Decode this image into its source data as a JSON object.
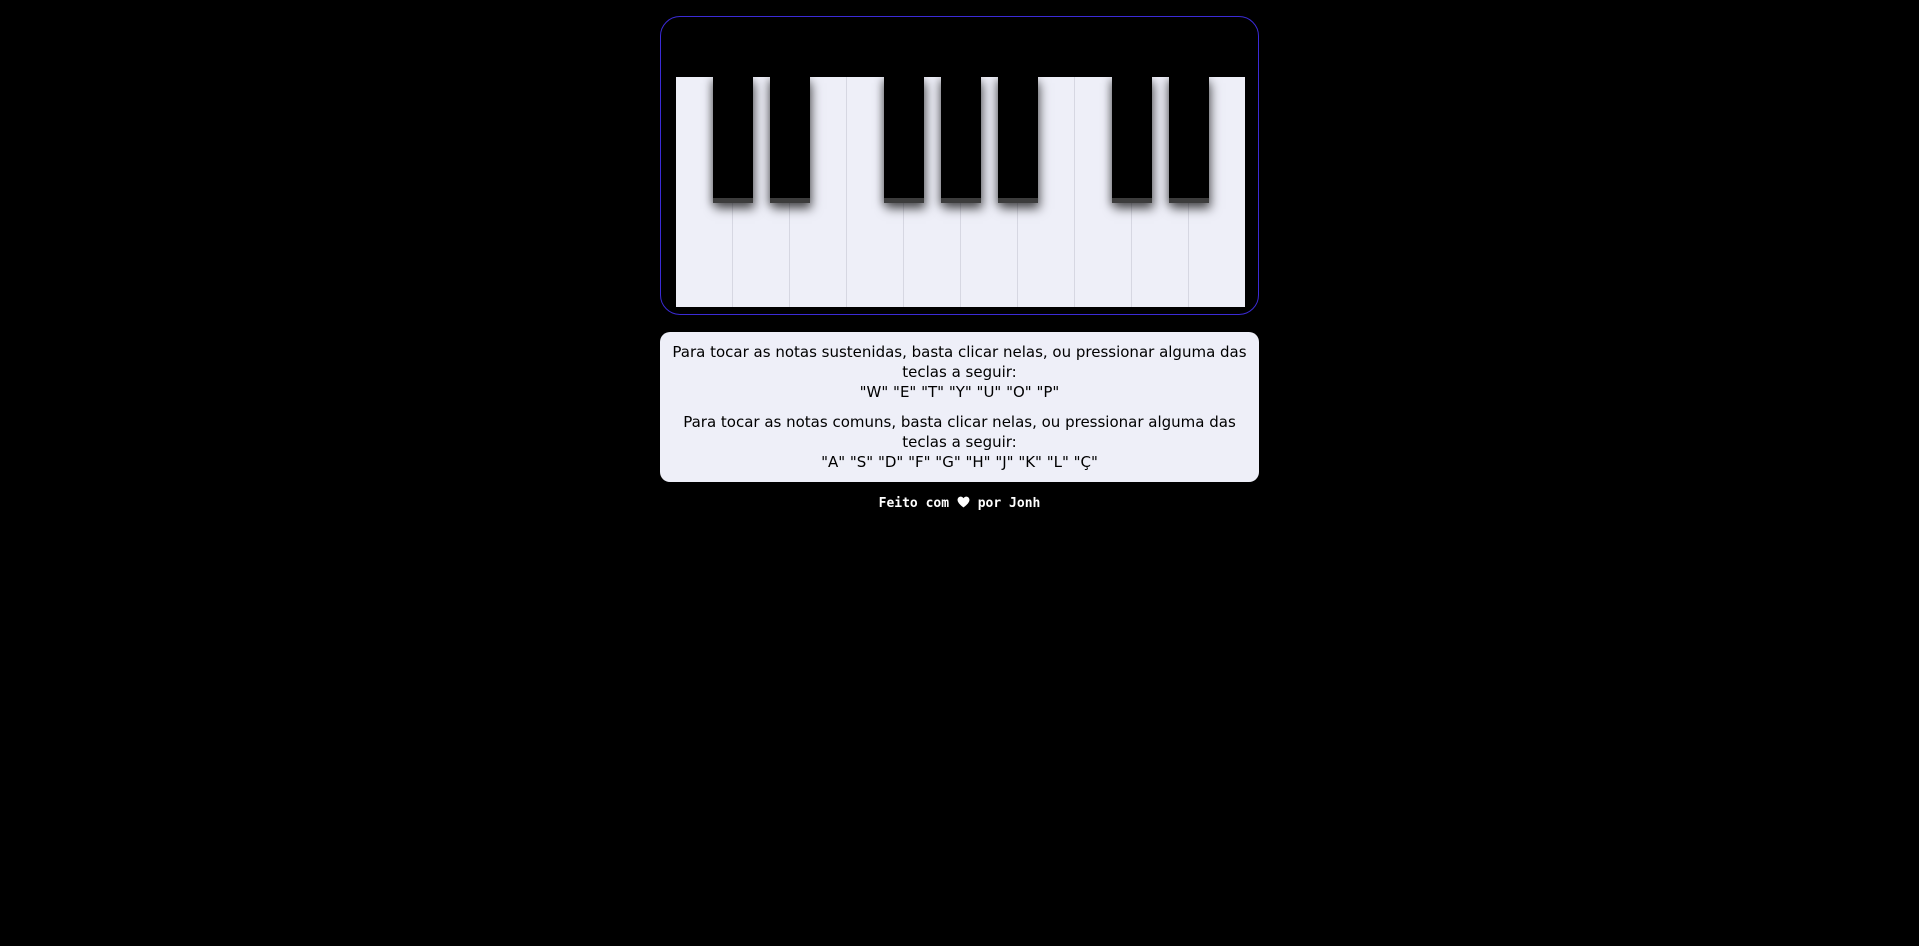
{
  "piano": {
    "frame_color": "#3b2bd6",
    "white_key_color": "#eeeff8",
    "black_key_color": "#000000",
    "white_key_count": 10,
    "black_key_count": 7
  },
  "instructions": {
    "sharps_text": "Para tocar as notas sustenidas, basta clicar nelas, ou pressionar alguma das teclas a seguir:",
    "sharps_keys": "\"W\" \"E\" \"T\" \"Y\" \"U\" \"O\" \"P\"",
    "naturals_text": "Para tocar as notas comuns, basta clicar nelas, ou pressionar alguma das teclas a seguir:",
    "naturals_keys": "\"A\" \"S\" \"D\" \"F\" \"G\" \"H\" \"J\" \"K\" \"L\" \"Ç\""
  },
  "footer": {
    "prefix": "Feito com",
    "heart_icon": "heart-icon",
    "suffix": "por Jonh"
  }
}
